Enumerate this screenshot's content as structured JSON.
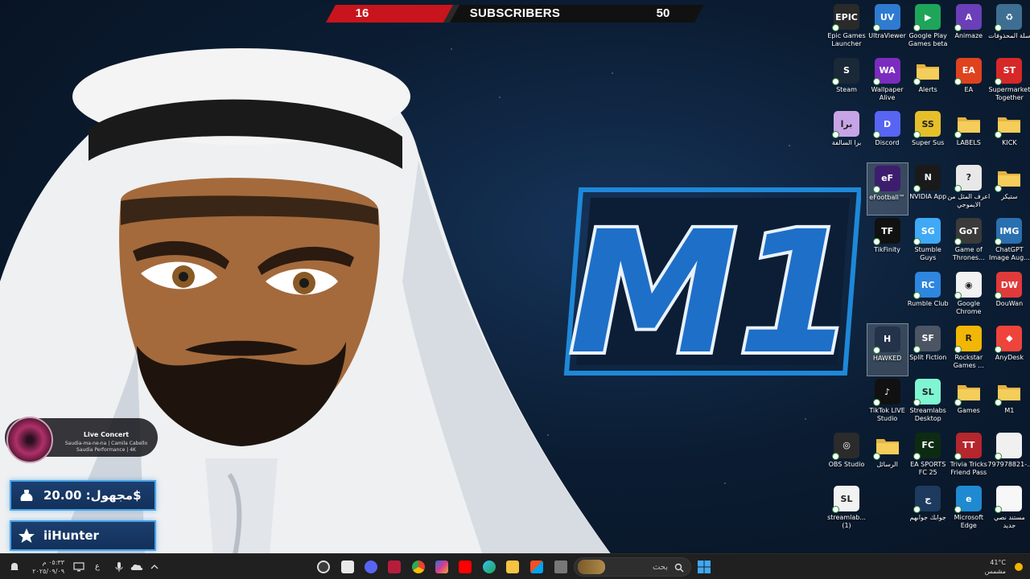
{
  "subscriber_bar": {
    "left_value": "16",
    "label": "SUBSCRIBERS",
    "right_value": "50"
  },
  "colors": {
    "accent_blue": "#1e88d8",
    "panel_border": "#4aa3e6",
    "counter_red": "#c8141c"
  },
  "desktop_icons": [
    {
      "label": "Epic Games Launcher",
      "icon": "epic-games-icon",
      "color": "#2a2a2a",
      "glyph": "EPIC"
    },
    {
      "label": "UltraViewer",
      "icon": "ultraviewer-icon",
      "color": "#2f7bd1",
      "glyph": "UV"
    },
    {
      "label": "Google Play Games beta",
      "icon": "google-play-games-icon",
      "color": "#1ea55a",
      "glyph": "▶"
    },
    {
      "label": "Animaze",
      "icon": "animaze-icon",
      "color": "#6a3fb8",
      "glyph": "A"
    },
    {
      "label": "سلة المحذوفات",
      "icon": "recycle-bin-icon",
      "color": "#3e6f93",
      "glyph": "♻"
    },
    {
      "label": "Steam",
      "icon": "steam-icon",
      "color": "#1b2838",
      "glyph": "S"
    },
    {
      "label": "Wallpaper Alive",
      "icon": "wallpaper-alive-icon",
      "color": "#7b2cbf",
      "glyph": "WA"
    },
    {
      "label": "Alerts",
      "icon": "folder-icon",
      "color": "#e3b341",
      "glyph": ""
    },
    {
      "label": "EA",
      "icon": "ea-icon",
      "color": "#e0421e",
      "glyph": "EA"
    },
    {
      "label": "Supermarket Together",
      "icon": "supermarket-together-icon",
      "color": "#d62828",
      "glyph": "ST"
    },
    {
      "label": "برا السالفة",
      "icon": "game-shortcut-icon",
      "color": "#c7a4e6",
      "glyph": "برا"
    },
    {
      "label": "Discord",
      "icon": "discord-icon",
      "color": "#5865f2",
      "glyph": "D"
    },
    {
      "label": "Super Sus",
      "icon": "super-sus-icon",
      "color": "#e6c02a",
      "glyph": "SS"
    },
    {
      "label": "LABELS",
      "icon": "folder-icon",
      "color": "#e3b341",
      "glyph": ""
    },
    {
      "label": "KICK",
      "icon": "folder-icon",
      "color": "#e3b341",
      "glyph": ""
    },
    {
      "label": "eFootball™",
      "icon": "efootball-icon",
      "color": "#3d1d6e",
      "glyph": "eF"
    },
    {
      "label": "NVIDIA App",
      "icon": "nvidia-icon",
      "color": "#1a1a1a",
      "glyph": "N"
    },
    {
      "label": "اعرف المثل من الايموجي",
      "icon": "emoji-game-icon",
      "color": "#e8e8e8",
      "glyph": "?"
    },
    {
      "label": "ستيكر",
      "icon": "folder-icon",
      "color": "#e3b341",
      "glyph": ""
    },
    {
      "label": "TikFinity",
      "icon": "tikfinity-icon",
      "color": "#111111",
      "glyph": "TF"
    },
    {
      "label": "Stumble Guys",
      "icon": "stumble-guys-icon",
      "color": "#3fa9f5",
      "glyph": "SG"
    },
    {
      "label": "Game of Thrones...",
      "icon": "game-of-thrones-icon",
      "color": "#3a3a3a",
      "glyph": "GoT"
    },
    {
      "label": "ChatGPT Image Aug...",
      "icon": "image-file-icon",
      "color": "#2a6fb0",
      "glyph": "IMG"
    },
    {
      "label": "Rumble Club",
      "icon": "rumble-club-icon",
      "color": "#2e86de",
      "glyph": "RC"
    },
    {
      "label": "Google Chrome",
      "icon": "chrome-icon",
      "color": "#f2f2f2",
      "glyph": "◉"
    },
    {
      "label": "DouWan",
      "icon": "douwan-icon",
      "color": "#e03a3a",
      "glyph": "DW"
    },
    {
      "label": "HAWKED",
      "icon": "hawked-icon",
      "color": "#24324a",
      "glyph": "H"
    },
    {
      "label": "Split Fiction",
      "icon": "split-fiction-icon",
      "color": "#4b5563",
      "glyph": "SF"
    },
    {
      "label": "Rockstar Games ...",
      "icon": "rockstar-icon",
      "color": "#f2b705",
      "glyph": "R"
    },
    {
      "label": "AnyDesk",
      "icon": "anydesk-icon",
      "color": "#ef443b",
      "glyph": "◆"
    },
    {
      "label": "TikTok LIVE Studio",
      "icon": "tiktok-live-icon",
      "color": "#111111",
      "glyph": "♪"
    },
    {
      "label": "Streamlabs Desktop",
      "icon": "streamlabs-icon",
      "color": "#80f5d2",
      "glyph": "SL"
    },
    {
      "label": "Games",
      "icon": "folder-icon",
      "color": "#e3b341",
      "glyph": ""
    },
    {
      "label": "M1",
      "icon": "folder-icon",
      "color": "#e3b341",
      "glyph": ""
    },
    {
      "label": "OBS Studio",
      "icon": "obs-icon",
      "color": "#2b2b2b",
      "glyph": "◎"
    },
    {
      "label": "الرسائل",
      "icon": "folder-icon",
      "color": "#e3b341",
      "glyph": ""
    },
    {
      "label": "EA SPORTS FC 25",
      "icon": "ea-fc-icon",
      "color": "#0d2b12",
      "glyph": "FC"
    },
    {
      "label": "Trivia Tricks Friend Pass",
      "icon": "trivia-tricks-icon",
      "color": "#b5262d",
      "glyph": "TT"
    },
    {
      "label": "797978821-...",
      "icon": "document-icon",
      "color": "#f0f0f0",
      "glyph": ""
    },
    {
      "label": "streamlab... (1)",
      "icon": "streamlabs-icon",
      "color": "#f2f2f2",
      "glyph": "SL"
    },
    {
      "label": "جوابك جوابهم",
      "icon": "game-shortcut-icon",
      "color": "#1e3a5f",
      "glyph": "ج"
    },
    {
      "label": "Microsoft Edge",
      "icon": "edge-icon",
      "color": "#1f8ad2",
      "glyph": "e"
    },
    {
      "label": "مستند نصي جديد",
      "icon": "text-document-icon",
      "color": "#f7f7f7",
      "glyph": ""
    }
  ],
  "now_playing": {
    "title": "Live Concert",
    "subtitle": "Saudia-ma-ne-na | Camila Cabello Saudia Performance | 4K"
  },
  "donation": {
    "text": "مجهول: 20.00$",
    "icon": "money-bag-icon"
  },
  "follower": {
    "text": "iiHunter",
    "icon": "star-icon"
  },
  "taskbar": {
    "search_placeholder": "بحث",
    "weather_temp": "41°C",
    "weather_desc": "مشمس",
    "time": "٠٥:٣٣ م",
    "date": "٢٠٢٥/٠٩/٠٩",
    "lang": "ع"
  }
}
